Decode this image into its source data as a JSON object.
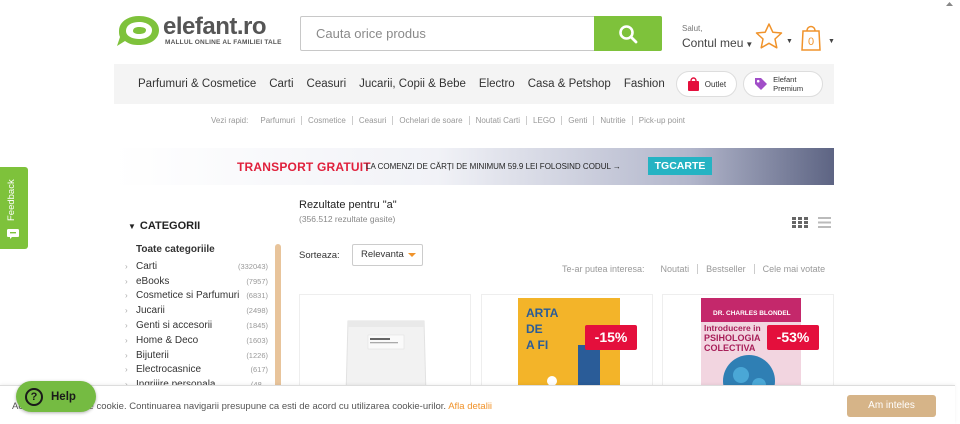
{
  "header": {
    "logo_text": "elefant.ro",
    "logo_tagline": "MALLUL ONLINE AL FAMILIEI TALE",
    "search_placeholder": "Cauta orice produs",
    "account_greeting": "Salut,",
    "account_label": "Contul meu",
    "cart_count": "0",
    "brand_color": "#7ec23b",
    "accent_color": "#f0932b"
  },
  "nav": {
    "items": [
      "Parfumuri & Cosmetice",
      "Carti",
      "Ceasuri",
      "Jucarii, Copii & Bebe",
      "Electro",
      "Casa & Petshop",
      "Fashion"
    ],
    "outlet_label": "Outlet",
    "premium_label_line1": "Elefant",
    "premium_label_line2": "Premium"
  },
  "quick_links": {
    "label": "Vezi rapid:",
    "items": [
      "Parfumuri",
      "Cosmetice",
      "Ceasuri",
      "Ochelari de soare",
      "Noutati Carti",
      "LEGO",
      "Genti",
      "Nutritie",
      "Pick-up point"
    ]
  },
  "banner": {
    "main": "TRANSPORT GRATUIT",
    "sub": "LA COMENZI DE CĂRȚI DE MINIMUM 59.9 LEI FOLOSIND CODUL →",
    "code": "TGCARTE"
  },
  "feedback_label": "Feedback",
  "sidebar": {
    "heading": "CATEGORII",
    "all_label": "Toate categoriile",
    "categories": [
      {
        "name": "Carti",
        "count": "(332043)"
      },
      {
        "name": "eBooks",
        "count": "(7957)"
      },
      {
        "name": "Cosmetice si Parfumuri",
        "count": "(6831)"
      },
      {
        "name": "Jucarii",
        "count": "(2498)"
      },
      {
        "name": "Genti si accesorii",
        "count": "(1845)"
      },
      {
        "name": "Home & Deco",
        "count": "(1603)"
      },
      {
        "name": "Bijuterii",
        "count": "(1226)"
      },
      {
        "name": "Electrocasnice",
        "count": "(617)"
      },
      {
        "name": "Ingrijire personala",
        "count": "(48..."
      }
    ]
  },
  "results": {
    "title": "Rezultate pentru \"a\"",
    "count": "(356.512 rezultate gasite)",
    "sort_label": "Sorteaza:",
    "sort_value": "Relevanta",
    "interest_label": "Te-ar putea interesa:",
    "interest_options": [
      "Noutati",
      "Bestseller",
      "Cele mai votate"
    ]
  },
  "products": [
    {
      "discount": ""
    },
    {
      "discount": "-15%",
      "cover_title_lines": [
        "ARTA",
        "DE",
        "A FI"
      ]
    },
    {
      "discount": "-53%",
      "cover_author": "DR. CHARLES BLONDEL",
      "cover_title_lines": [
        "Introducere in",
        "PSIHOLOGIA",
        "COLECTIVA"
      ]
    }
  ],
  "cookie": {
    "text": "Acest site foloseste cookie. Continuarea navigarii presupune ca esti de acord cu utilizarea cookie-urilor.",
    "link": "Afla detalii",
    "button": "Am inteles"
  },
  "help_label": "Help"
}
